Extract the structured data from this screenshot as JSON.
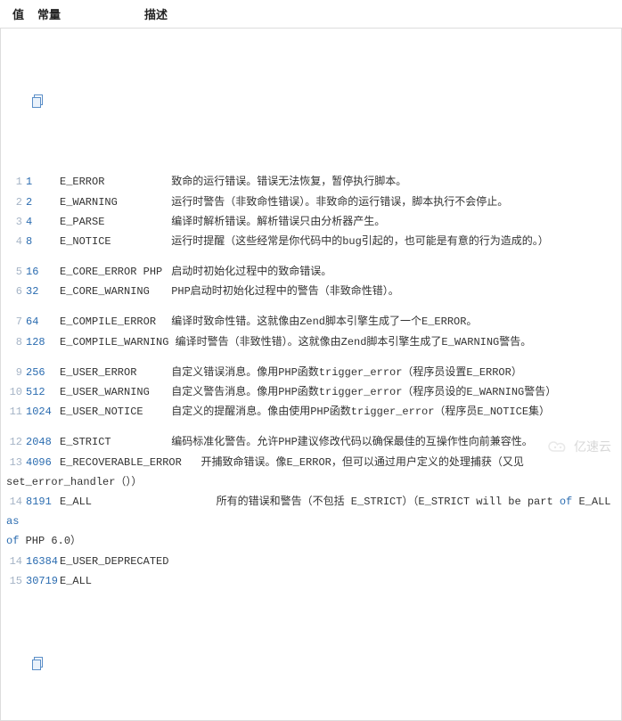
{
  "headers": {
    "value": "值",
    "constant": "常量",
    "description": "描述"
  },
  "watermark": "亿速云",
  "groups": [
    [
      {
        "n": 1,
        "val": "1",
        "const": "E_ERROR",
        "desc": "致命的运行错误。错误无法恢复，暂停执行脚本。"
      },
      {
        "n": 2,
        "val": "2",
        "const": "E_WARNING",
        "desc": "运行时警告（非致命性错误）。非致命的运行错误，脚本执行不会停止。"
      },
      {
        "n": 3,
        "val": "4",
        "const": "E_PARSE",
        "desc": "编译时解析错误。解析错误只由分析器产生。"
      },
      {
        "n": 4,
        "val": "8",
        "const": "E_NOTICE",
        "desc": "运行时提醒（这些经常是你代码中的bug引起的，也可能是有意的行为造成的。）"
      }
    ],
    [
      {
        "n": 5,
        "val": "16",
        "const": "E_CORE_ERROR PHP",
        "desc": "启动时初始化过程中的致命错误。"
      },
      {
        "n": 6,
        "val": "32",
        "const": "E_CORE_WARNING",
        "desc": "PHP启动时初始化过程中的警告（非致命性错）。"
      }
    ],
    [
      {
        "n": 7,
        "val": "64",
        "const": "E_COMPILE_ERROR",
        "desc": "编译时致命性错。这就像由Zend脚本引擎生成了一个E_ERROR。"
      },
      {
        "n": 8,
        "val": "128",
        "const": "E_COMPILE_WARNING",
        "desc": "编译时警告（非致性错）。这就像由Zend脚本引擎生成了E_WARNING警告。"
      }
    ],
    [
      {
        "n": 9,
        "val": "256",
        "const": "E_USER_ERROR",
        "desc": "自定义错误消息。像用PHP函数trigger_error（程序员设置E_ERROR）"
      },
      {
        "n": 10,
        "val": "512",
        "const": "E_USER_WARNING",
        "desc": "自定义警告消息。像用PHP函数trigger_error（程序员设的E_WARNING警告）"
      },
      {
        "n": 11,
        "val": "1024",
        "const": "E_USER_NOTICE",
        "desc": "自定义的提醒消息。像由使用PHP函数trigger_error（程序员E_NOTICE集）"
      }
    ],
    [
      {
        "n": 12,
        "val": "2048",
        "const": "E_STRICT",
        "desc": "编码标准化警告。允许PHP建议修改代码以确保最佳的互操作性向前兼容性。"
      },
      {
        "n_a": 13,
        "val_a": "4096",
        "const_a": "E_RECOVERABLE_ERROR",
        "desc_a": "开捕致命错误。像E_ERROR，但可以通过用户定义的处理捕获（又见",
        "cont": "set_error_handler（））",
        "wrap": true
      },
      {
        "n_a": 14,
        "val_a": "8191",
        "const_a": "E_ALL",
        "desc_a": "所有的错误和警告（不包括 E_STRICT）（E_STRICT will be part ",
        "kw1": "of",
        "kw2": " E_ALL ",
        "kw3": "as",
        "cont_pre": "of",
        "cont": " PHP 6.0）",
        "wrap2": true
      },
      {
        "n": 14,
        "val": "16384",
        "const": "E_USER_DEPRECATED",
        "desc": ""
      },
      {
        "n": 15,
        "val": "30719",
        "const": "E_ALL",
        "desc": ""
      }
    ]
  ]
}
